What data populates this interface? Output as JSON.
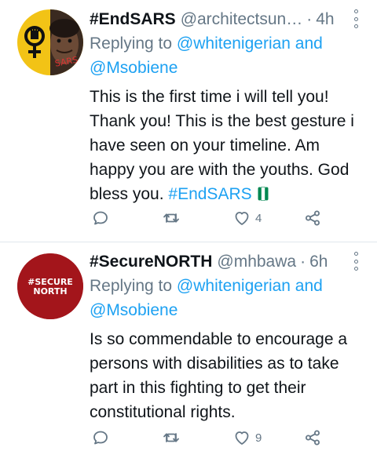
{
  "tweets": [
    {
      "name": "#EndSARS",
      "handle": "@architectsun…",
      "separator": "·",
      "time": "4h",
      "replying_prefix": "Replying to ",
      "reply_to_1": "@whitenigerian",
      "reply_and": " and",
      "reply_to_2": "@Msobiene",
      "text": "This is the first time i will tell you! Thank you! This is the best gesture i have seen on your timeline. Am happy you are with the youths. God bless you. ",
      "hashtag": "#EndSARS",
      "like_count": "4",
      "avatar_text": "SARS"
    },
    {
      "name": "#SecureNORTH",
      "handle": "@mhbawa",
      "separator": "·",
      "time": "6h",
      "replying_prefix": "Replying to ",
      "reply_to_1": "@whitenigerian",
      "reply_and": " and",
      "reply_to_2": "@Msobiene",
      "text": "Is so commendable to encourage a persons with disabilities as to take part in this fighting to get their constitutional rights.",
      "like_count": "9",
      "avatar_line1": "#SECURE",
      "avatar_line2": "NORTH"
    }
  ],
  "icons": {
    "reply": "reply-icon",
    "retweet": "retweet-icon",
    "like": "heart-icon",
    "share": "share-icon",
    "more": "more-vertical-icon"
  },
  "colors": {
    "link": "#1da1f2",
    "muted": "#657786",
    "divider": "#e1e8ed",
    "securenorth_red": "#a3151b",
    "nigeria_green": "#008751"
  }
}
